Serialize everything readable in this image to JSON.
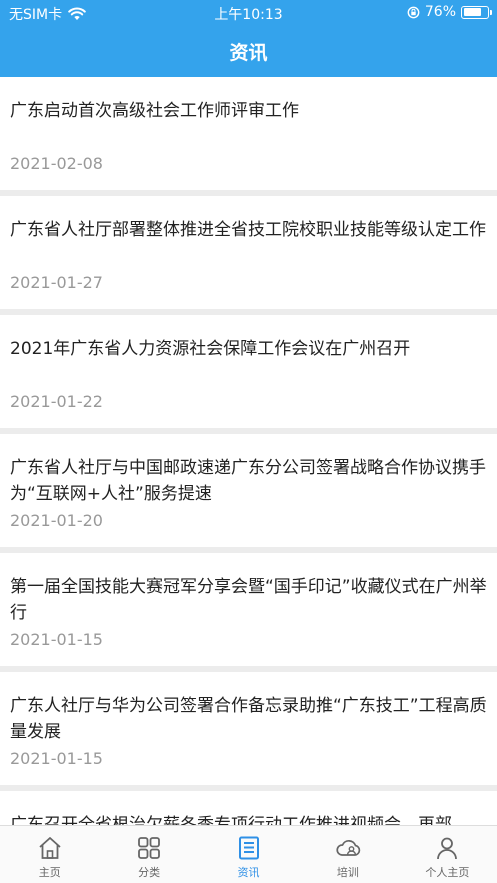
{
  "status_bar": {
    "carrier": "无SIM卡",
    "time": "上午10:13",
    "battery": "76%",
    "battery_level": 0.76
  },
  "header": {
    "title": "资讯"
  },
  "news": [
    {
      "title": "广东启动首次高级社会工作师评审工作",
      "date": "2021-02-08"
    },
    {
      "title": "广东省人社厅部署整体推进全省技工院校职业技能等级认定工作",
      "date": "2021-01-27"
    },
    {
      "title": "2021年广东省人力资源社会保障工作会议在广州召开",
      "date": "2021-01-22"
    },
    {
      "title": "广东省人社厅与中国邮政速递广东分公司签署战略合作协议携手为“互联网+人社”服务提速",
      "date": "2021-01-20"
    },
    {
      "title": "第一届全国技能大赛冠军分享会暨“国手印记”收藏仪式在广州举行",
      "date": "2021-01-15"
    },
    {
      "title": "广东人社厅与华为公司签署合作备忘录助推“广东技工”工程高质量发展",
      "date": "2021-01-15"
    },
    {
      "title": "广东召开全省根治欠薪冬季专项行动工作推进视频会，再部",
      "date": ""
    }
  ],
  "tabs": [
    {
      "label": "主页",
      "icon": "home-icon"
    },
    {
      "label": "分类",
      "icon": "grid-icon"
    },
    {
      "label": "资讯",
      "icon": "news-icon",
      "active": true
    },
    {
      "label": "培训",
      "icon": "cloud-people-icon"
    },
    {
      "label": "个人主页",
      "icon": "person-icon"
    }
  ],
  "colors": {
    "header": "#34a3ec",
    "active_tab": "#2f90e6",
    "date": "#999999"
  }
}
